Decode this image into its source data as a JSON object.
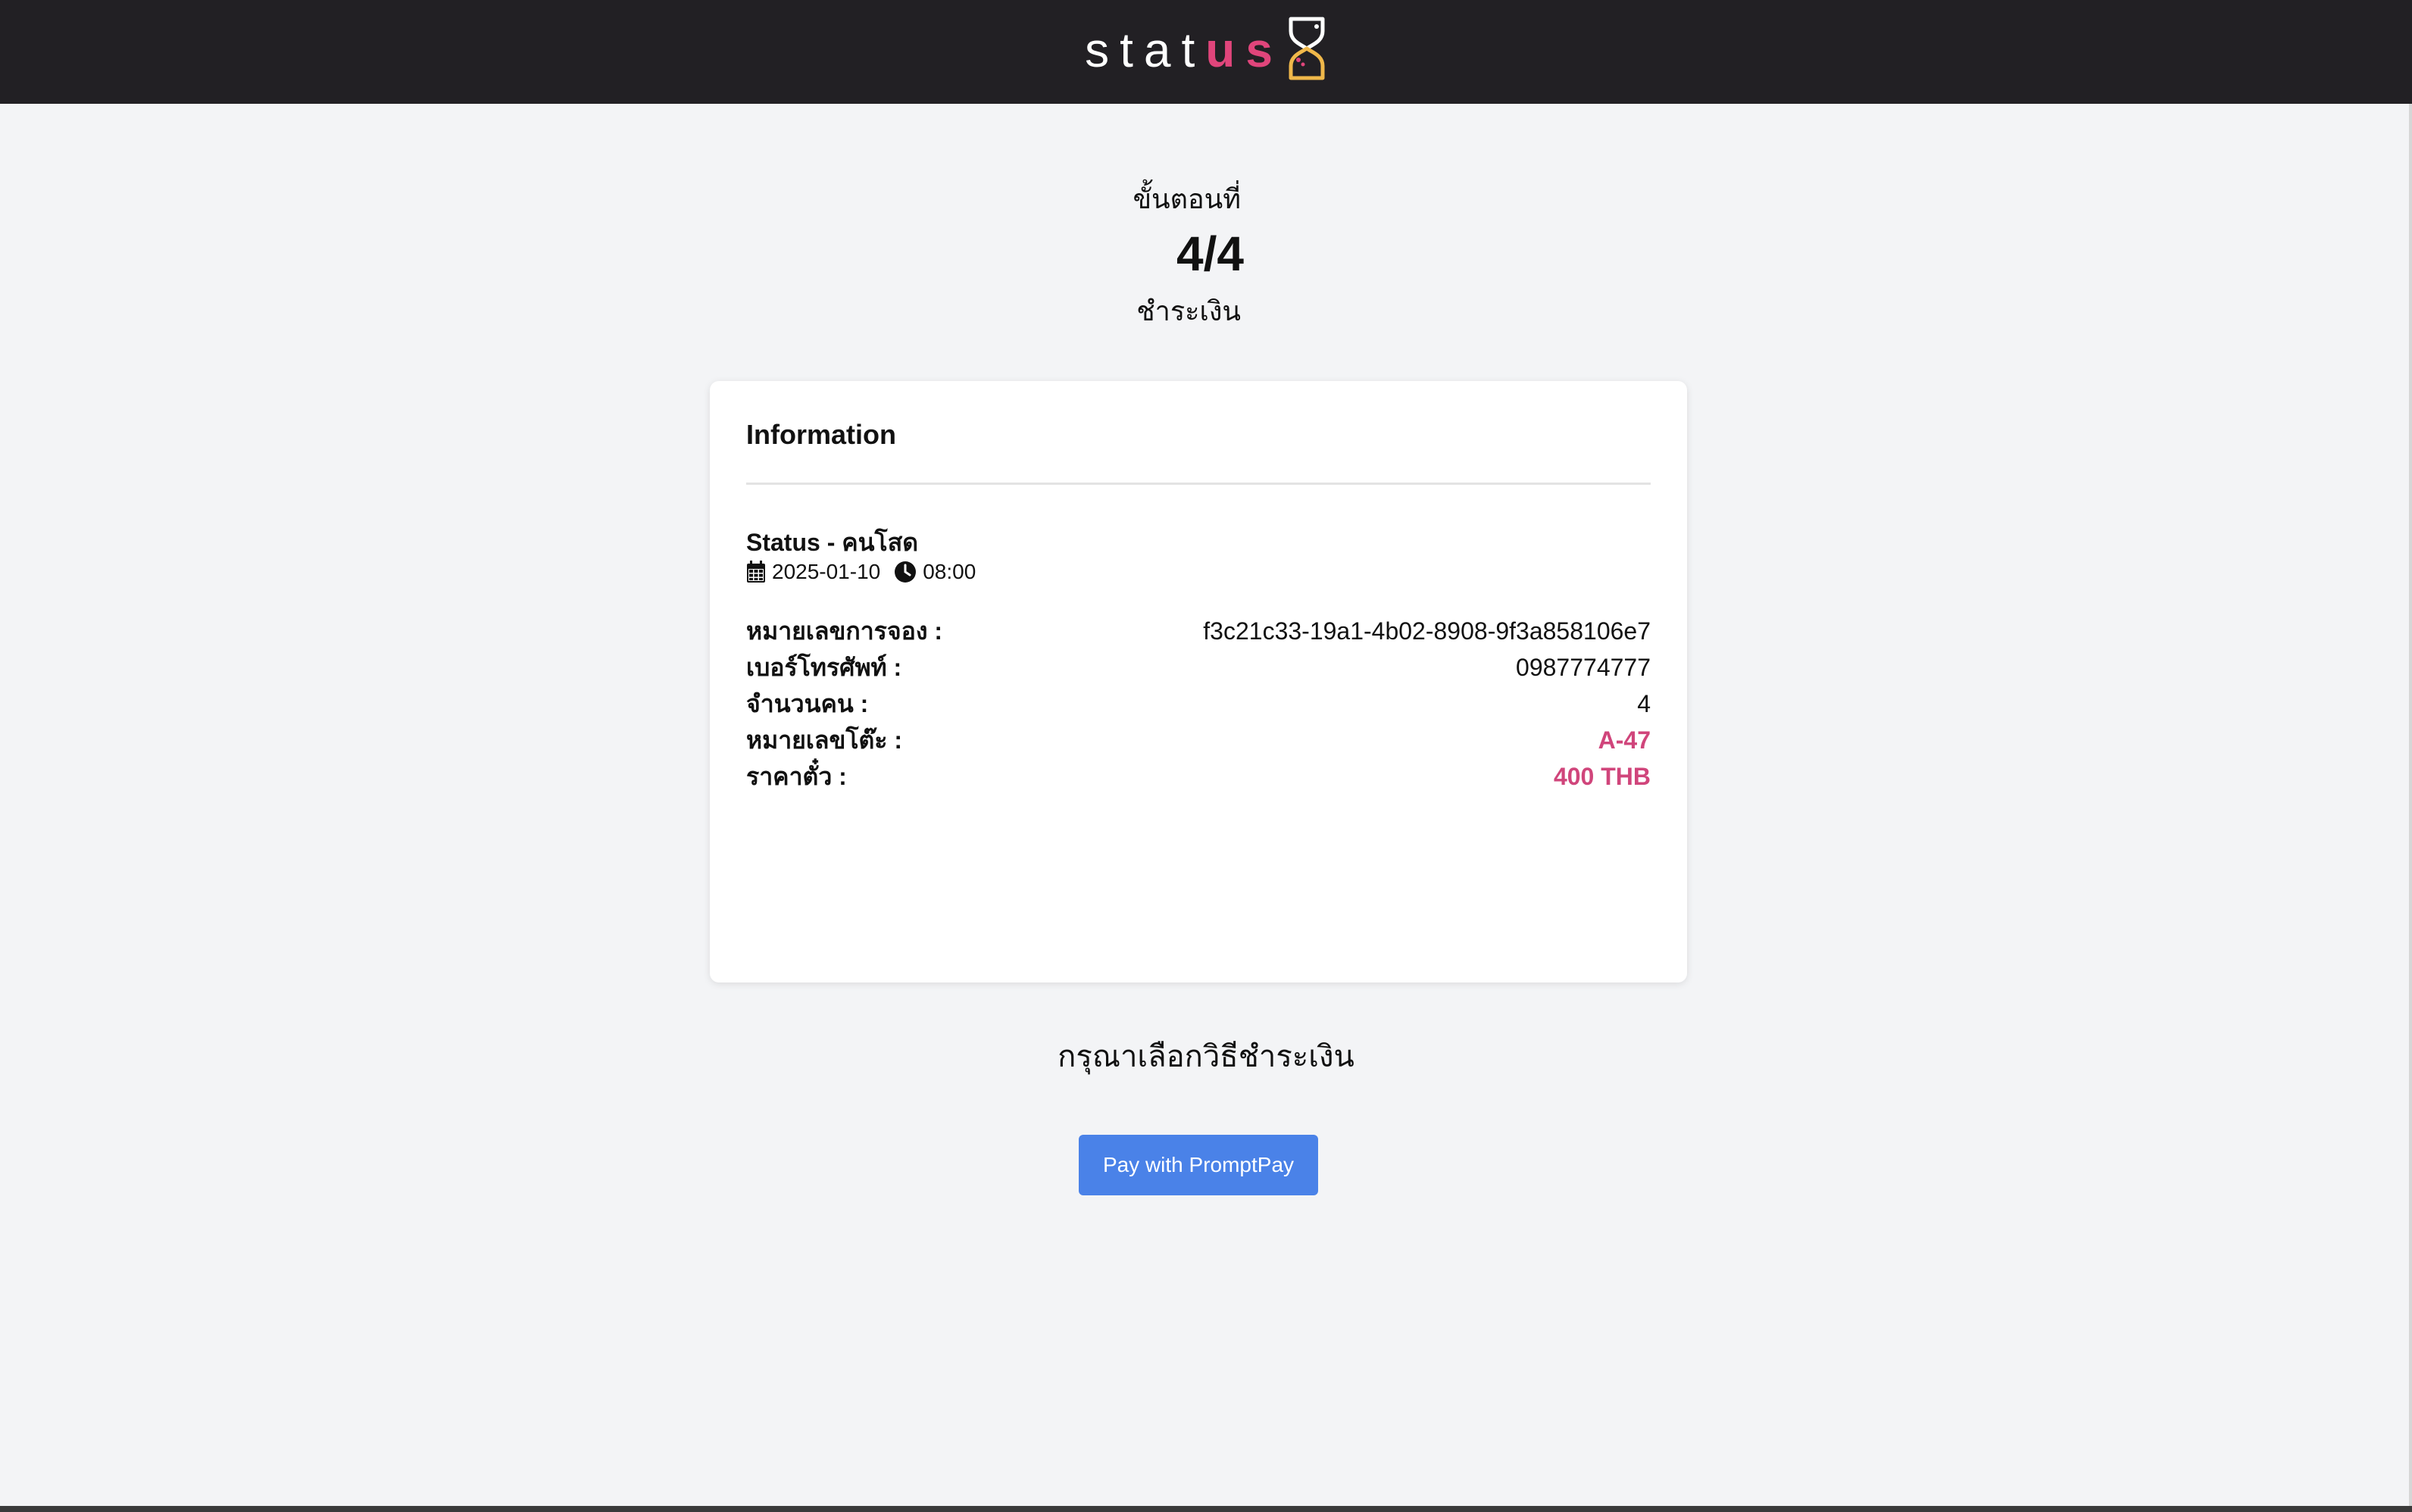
{
  "header": {
    "logo_plain": "stat",
    "logo_accent": "us",
    "logo_icon": "hourglass-icon",
    "colors": {
      "background": "#222024",
      "accent": "#e0457b",
      "icon": "#f0b84a"
    }
  },
  "step": {
    "label": "ขั้นตอนที่",
    "count": "4/4",
    "name": "ชำระเงิน"
  },
  "info": {
    "title": "Information",
    "event_title": "Status - คนโสด",
    "date": "2025-01-10",
    "time": "08:00",
    "date_icon": "calendar-icon",
    "time_icon": "clock-icon",
    "details": [
      {
        "label": "หมายเลขการจอง :",
        "value": "f3c21c33-19a1-4b02-8908-9f3a858106e7"
      },
      {
        "label": "เบอร์โทรศัพท์ :",
        "value": "0987774777"
      },
      {
        "label": "จำนวนคน :",
        "value": "4"
      },
      {
        "label": "หมายเลขโต๊ะ :",
        "value": "A-47"
      },
      {
        "label": "ราคาตั๋ว :",
        "value": "400 THB"
      }
    ],
    "accent_color": "#d0457b"
  },
  "payment": {
    "prompt": "กรุณาเลือกวิธีชำระเงิน",
    "button_label": "Pay with PromptPay",
    "button_color": "#4a82e8"
  }
}
